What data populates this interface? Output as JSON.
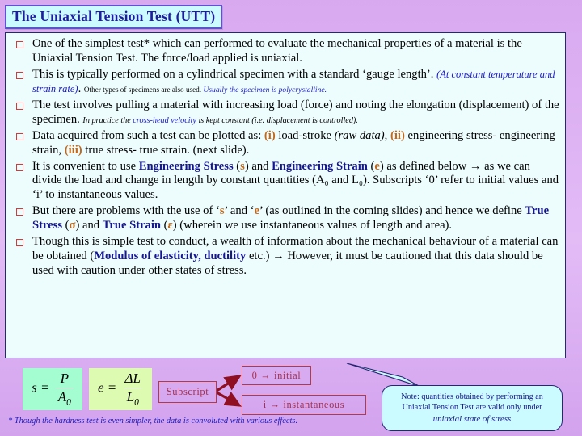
{
  "slide": {
    "title": "The Uniaxial Tension Test (UTT)"
  },
  "bullets": [
    {
      "id": "bullet-1",
      "segments": [
        {
          "text": "One of the simplest test* which can performed to evaluate the mechanical properties of a material is the Uniaxial Tension Test. The force/load applied is uniaxial.",
          "style": "normal"
        }
      ]
    },
    {
      "id": "bullet-2",
      "segments": [
        {
          "text": "This is typically performed on a cylindrical specimen with a standard ‘gauge length’. ",
          "style": "normal"
        },
        {
          "text": "(At constant temperature and strain rate)",
          "style": "sm1"
        },
        {
          "text": ". ",
          "style": "normal"
        },
        {
          "text": "Other types of specimens are also used. ",
          "style": "sm2"
        },
        {
          "text": "Usually the specimen is polycrystalline.",
          "style": "sm2i"
        }
      ]
    },
    {
      "id": "bullet-3",
      "segments": [
        {
          "text": "The test involves pulling a material with increasing load (force) and noting the elongation (displacement) of the specimen. ",
          "style": "normal"
        },
        {
          "text": "In practice the ",
          "style": "sm3"
        },
        {
          "text": "cross-head velocity",
          "style": "sm3b"
        },
        {
          "text": " is kept constant (i.e. displacement is controlled).",
          "style": "sm3"
        }
      ]
    },
    {
      "id": "bullet-4",
      "segments": [
        {
          "text": "Data acquired from such a test can be plotted as: ",
          "style": "normal"
        },
        {
          "text": "(i)",
          "style": "orange-paren"
        },
        {
          "text": " load-stroke ",
          "style": "normal"
        },
        {
          "text": "(raw data)",
          "style": "ital"
        },
        {
          "text": ", ",
          "style": "normal"
        },
        {
          "text": "(ii)",
          "style": "orange-paren"
        },
        {
          "text": " engineering stress- engineering strain, ",
          "style": "normal"
        },
        {
          "text": "(iii)",
          "style": "orange-paren"
        },
        {
          "text": " true stress- true strain. (next slide).",
          "style": "normal"
        }
      ]
    },
    {
      "id": "bullet-5",
      "segments": [
        {
          "text": "It is convenient to use ",
          "style": "normal"
        },
        {
          "text": "Engineering Stress",
          "style": "navy"
        },
        {
          "text": " (",
          "style": "normal"
        },
        {
          "text": "s",
          "style": "orange"
        },
        {
          "text": ") and ",
          "style": "normal"
        },
        {
          "text": "Engineering Strain",
          "style": "navy"
        },
        {
          "text": " (",
          "style": "normal"
        },
        {
          "text": "e",
          "style": "orange"
        },
        {
          "text": ") as defined below → as we can divide the load and change in length by constant quantities (A₀ and L₀). Subscripts ‘0’ refer to initial values and ‘i’ to instantaneous values.",
          "style": "normal"
        }
      ]
    },
    {
      "id": "bullet-6",
      "segments": [
        {
          "text": "But there are problems with the use of ‘",
          "style": "normal"
        },
        {
          "text": "s",
          "style": "orange"
        },
        {
          "text": "’ and ‘",
          "style": "normal"
        },
        {
          "text": "e",
          "style": "orange"
        },
        {
          "text": "’ (as outlined in the coming slides) and hence we define ",
          "style": "normal"
        },
        {
          "text": "True Stress",
          "style": "navy"
        },
        {
          "text": " (",
          "style": "normal"
        },
        {
          "text": "σ",
          "style": "orange"
        },
        {
          "text": ") and ",
          "style": "normal"
        },
        {
          "text": "True Strain",
          "style": "navy"
        },
        {
          "text": " (",
          "style": "normal"
        },
        {
          "text": "ε",
          "style": "orange"
        },
        {
          "text": ") (wherein we use instantaneous values of length and area).",
          "style": "normal"
        }
      ]
    },
    {
      "id": "bullet-7",
      "segments": [
        {
          "text": "Though this is simple test to conduct, a wealth of information about the mechanical behaviour of a material can be obtained (",
          "style": "normal"
        },
        {
          "text": "Modulus of elasticity, ductility",
          "style": "navy"
        },
        {
          "text": " etc.) → However, it must be cautioned that this data should be used with caution under other states of stress.",
          "style": "normal"
        }
      ]
    }
  ],
  "formulas": {
    "stress": {
      "lhs": "s =",
      "numerator": "P",
      "denominator": "A",
      "denominator_sub": "0"
    },
    "strain": {
      "lhs": "e =",
      "numerator": "ΔL",
      "denominator": "L",
      "denominator_sub": "0"
    }
  },
  "subscript_diagram": {
    "label": "Subscript",
    "initial": "0 → initial",
    "instantaneous": "i → instantaneous"
  },
  "note": {
    "line1": "Note: quantities obtained by performing an",
    "line2": "Uniaxial Tension Test are valid only under",
    "line3": "uniaxial state of stress"
  },
  "footnote": {
    "text": "* Though the hardness test is even simpler, the data is convoluted with various effects."
  },
  "colors": {
    "background": "#dcb0f2",
    "panel_fill": "#edfcfd",
    "panel_border": "#262673",
    "title_fill": "#ccfbff",
    "title_border": "#5a55c8",
    "title_text": "#1d1d9e",
    "bullet_marker": "#d33a3a",
    "accent_blue": "#1c1cc4",
    "accent_navy": "#15158f",
    "accent_orange": "#c2681a",
    "redbox_border": "#b03a4a",
    "redbox_text": "#a8304a",
    "formula_s_fill": "#a4fdd0",
    "formula_e_fill": "#ddfcb2"
  }
}
